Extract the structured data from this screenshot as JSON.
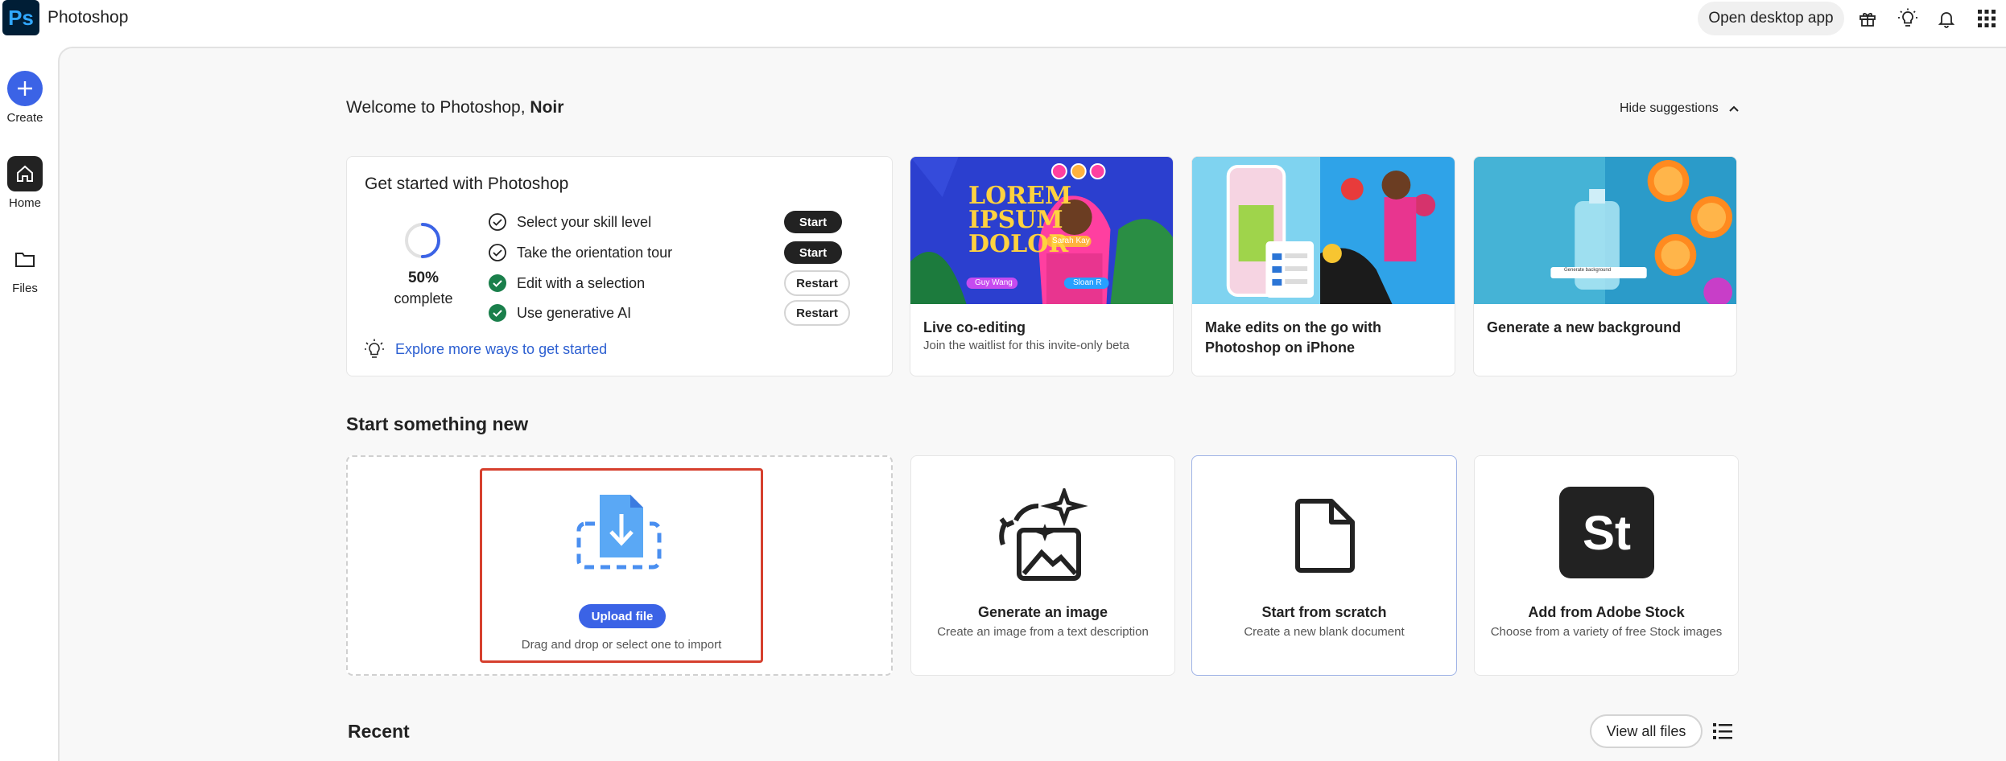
{
  "app": {
    "logo": "Ps",
    "name": "Photoshop"
  },
  "topbar": {
    "open_desktop_label": "Open desktop app",
    "icons": [
      "gift-icon",
      "lightbulb-icon",
      "bell-icon",
      "apps-grid-icon"
    ]
  },
  "rail": {
    "items": [
      {
        "label": "Create",
        "icon": "plus-icon"
      },
      {
        "label": "Home",
        "icon": "home-icon"
      },
      {
        "label": "Files",
        "icon": "folder-icon"
      }
    ]
  },
  "welcome": {
    "prefix": "Welcome to Photoshop, ",
    "name": "Noir"
  },
  "hide_suggestions": "Hide suggestions",
  "get_started": {
    "title": "Get started with Photoshop",
    "percent": "50%",
    "percent_value": 0.5,
    "complete_label": "complete",
    "tasks": [
      {
        "label": "Select your skill level",
        "done": false,
        "action": "Start"
      },
      {
        "label": "Take the orientation tour",
        "done": false,
        "action": "Start"
      },
      {
        "label": "Edit with a selection",
        "done": true,
        "action": "Restart"
      },
      {
        "label": "Use generative AI",
        "done": true,
        "action": "Restart"
      }
    ],
    "explore_label": "Explore more ways to get started"
  },
  "features": [
    {
      "title": "Live co-editing",
      "subtitle": "Join the waitlist for this invite-only beta",
      "image_text": [
        "LOREM",
        "IPSUM",
        "DOLOR"
      ],
      "tags": [
        "Sarah Kay",
        "Guy Wang",
        "Sloan R"
      ]
    },
    {
      "title": "Make edits on the go with",
      "title2": "Photoshop on iPhone",
      "subtitle": ""
    },
    {
      "title": "Generate a new background",
      "subtitle": "",
      "tags": [
        "Generate background"
      ]
    }
  ],
  "start_new": {
    "title": "Start something new",
    "upload": {
      "button": "Upload file",
      "subtitle": "Drag and drop or select one to import"
    },
    "cards": [
      {
        "title": "Generate an image",
        "subtitle": "Create an image from a text description",
        "icon": "ai-image-icon"
      },
      {
        "title": "Start from scratch",
        "subtitle": "Create a new blank document",
        "icon": "blank-document-icon"
      },
      {
        "title": "Add from Adobe Stock",
        "subtitle": "Choose from a variety of free Stock images",
        "icon": "adobe-stock-icon",
        "logo": "St"
      }
    ]
  },
  "recent": {
    "title": "Recent",
    "view_all": "View all files"
  },
  "colors": {
    "accent": "#3b63e6",
    "ps_bg": "#001e36",
    "ps_fg": "#31a8ff",
    "success": "#1a7f4b",
    "highlight": "#d6402e"
  }
}
